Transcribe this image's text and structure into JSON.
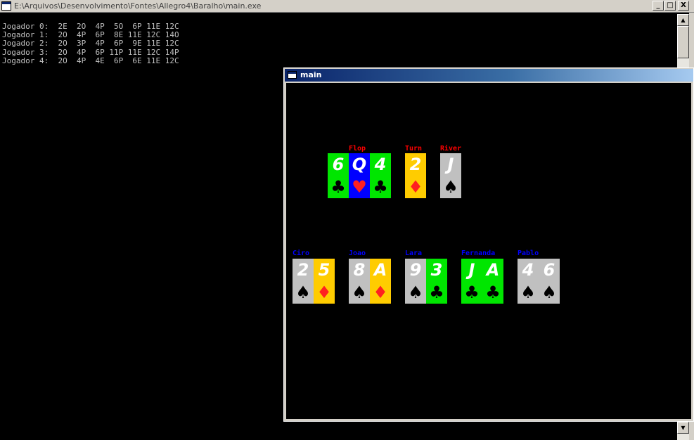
{
  "console": {
    "title": "E:\\Arquivos\\Desenvolvimento\\Fontes\\Allegro4\\Baralho\\main.exe",
    "controls": {
      "minimize": "_",
      "maximize": "□",
      "close": "X"
    },
    "lines": [
      "Jogador 0:  2E  2O  4P  5O  6P 11E 12C",
      "Jogador 1:  2O  4P  6P  8E 11E 12C 14O",
      "Jogador 2:  2O  3P  4P  6P  9E 11E 12C",
      "Jogador 3:  2O  4P  6P 11P 11E 12C 14P",
      "Jogador 4:  2O  4P  4E  6P  6E 11E 12C"
    ],
    "scroll_up": "▲",
    "scroll_down": "▼"
  },
  "allegro_window": {
    "title": "main",
    "board_labels": {
      "flop": "Flop",
      "turn": "Turn",
      "river": "River"
    },
    "board_cards": [
      {
        "rank": "6",
        "suit": "♣",
        "bg": "#00e600",
        "suit_color": "#000000"
      },
      {
        "rank": "Q",
        "suit": "♥",
        "bg": "#0000ff",
        "suit_color": "#ff2020"
      },
      {
        "rank": "4",
        "suit": "♣",
        "bg": "#00e600",
        "suit_color": "#000000"
      },
      {
        "rank": "2",
        "suit": "♦",
        "bg": "#ffcc00",
        "suit_color": "#ff2020"
      },
      {
        "rank": "J",
        "suit": "♠",
        "bg": "#c0c0c0",
        "suit_color": "#000000"
      }
    ],
    "players": [
      {
        "name": "Ciro",
        "cards": [
          {
            "rank": "2",
            "suit": "♠",
            "bg": "#c0c0c0",
            "suit_color": "#000000"
          },
          {
            "rank": "5",
            "suit": "♦",
            "bg": "#ffcc00",
            "suit_color": "#ff2020"
          }
        ]
      },
      {
        "name": "Joao",
        "cards": [
          {
            "rank": "8",
            "suit": "♠",
            "bg": "#c0c0c0",
            "suit_color": "#000000"
          },
          {
            "rank": "A",
            "suit": "♦",
            "bg": "#ffcc00",
            "suit_color": "#ff2020"
          }
        ]
      },
      {
        "name": "Lara",
        "cards": [
          {
            "rank": "9",
            "suit": "♠",
            "bg": "#c0c0c0",
            "suit_color": "#000000"
          },
          {
            "rank": "3",
            "suit": "♣",
            "bg": "#00e600",
            "suit_color": "#000000"
          }
        ]
      },
      {
        "name": "Fernanda",
        "cards": [
          {
            "rank": "J",
            "suit": "♣",
            "bg": "#00e600",
            "suit_color": "#000000"
          },
          {
            "rank": "A",
            "suit": "♣",
            "bg": "#00e600",
            "suit_color": "#000000"
          }
        ]
      },
      {
        "name": "Pablo",
        "cards": [
          {
            "rank": "4",
            "suit": "♠",
            "bg": "#c0c0c0",
            "suit_color": "#000000"
          },
          {
            "rank": "6",
            "suit": "♠",
            "bg": "#c0c0c0",
            "suit_color": "#000000"
          }
        ]
      }
    ],
    "colors": {
      "board_label": "#ff0000",
      "player_label": "#0000ff"
    }
  }
}
